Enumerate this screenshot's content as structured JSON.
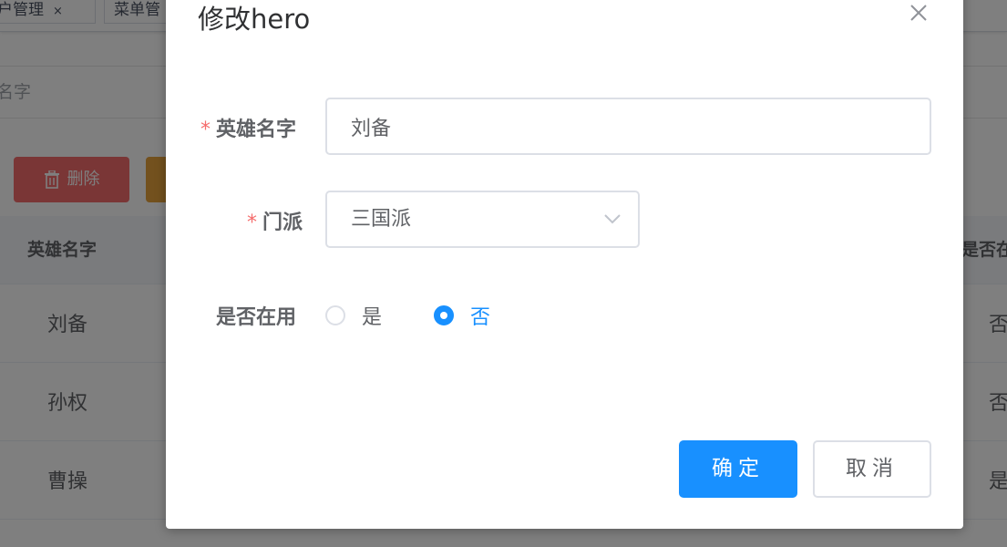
{
  "background": {
    "tabs": [
      {
        "label": "户管理",
        "close": "×"
      },
      {
        "label": "菜单管"
      }
    ],
    "search_placeholder": "名字",
    "toolbar": {
      "delete_label": "删除"
    },
    "table": {
      "headers": {
        "name": "英雄名字",
        "used": "是否在"
      },
      "rows": [
        {
          "name": "刘备",
          "used": "否"
        },
        {
          "name": "孙权",
          "used": "否"
        },
        {
          "name": "曹操",
          "used": "是"
        }
      ]
    }
  },
  "dialog": {
    "title": "修改hero",
    "close_icon": "close-icon",
    "form": {
      "name": {
        "label": "英雄名字",
        "required_mark": "*",
        "value": "刘备"
      },
      "sect": {
        "label": "门派",
        "required_mark": "*",
        "value": "三国派"
      },
      "in_use": {
        "label": "是否在用",
        "options": [
          {
            "label": "是",
            "checked": false
          },
          {
            "label": "否",
            "checked": true
          }
        ]
      }
    },
    "buttons": {
      "confirm": "确定",
      "cancel": "取消"
    }
  },
  "colors": {
    "primary": "#1890ff",
    "danger": "#f56c6c",
    "warning": "#e6a23c",
    "required": "#f56c6c",
    "mask": "rgba(0,0,0,0.5)"
  }
}
